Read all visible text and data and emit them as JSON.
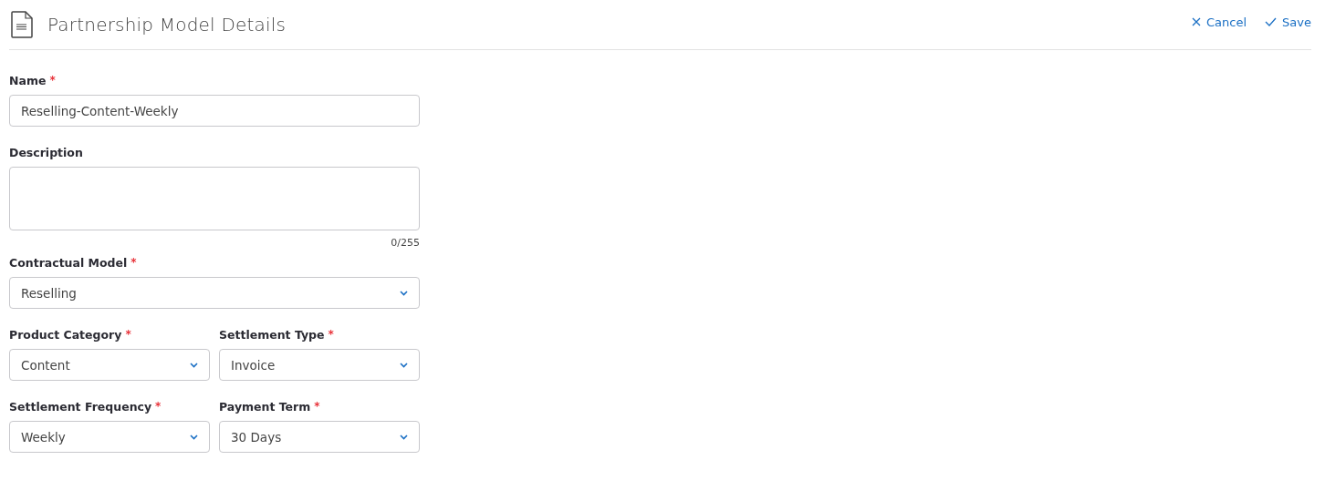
{
  "header": {
    "title": "Partnership Model Details",
    "actions": [
      {
        "kind": "cancel",
        "label": "Cancel"
      },
      {
        "kind": "save",
        "label": "Save"
      }
    ]
  },
  "rows": [
    [
      {
        "kind": "text",
        "label": "Name",
        "required_mark": "*",
        "value": "Reselling-Content-Weekly"
      }
    ],
    [
      {
        "kind": "textarea",
        "label": "Description",
        "counter": "0/255"
      }
    ],
    [
      {
        "kind": "select",
        "label": "Contractual Model",
        "required_mark": "*",
        "value": "Reselling"
      }
    ],
    [
      {
        "kind": "select",
        "label": "Product Category",
        "required_mark": "*",
        "value": "Content"
      },
      {
        "kind": "select",
        "label": "Settlement Type",
        "required_mark": "*",
        "value": "Invoice"
      }
    ],
    [
      {
        "kind": "select",
        "label": "Settlement Frequency",
        "required_mark": "*",
        "value": "Weekly"
      },
      {
        "kind": "select",
        "label": "Payment Term",
        "required_mark": "*",
        "value": "30 Days"
      }
    ]
  ]
}
